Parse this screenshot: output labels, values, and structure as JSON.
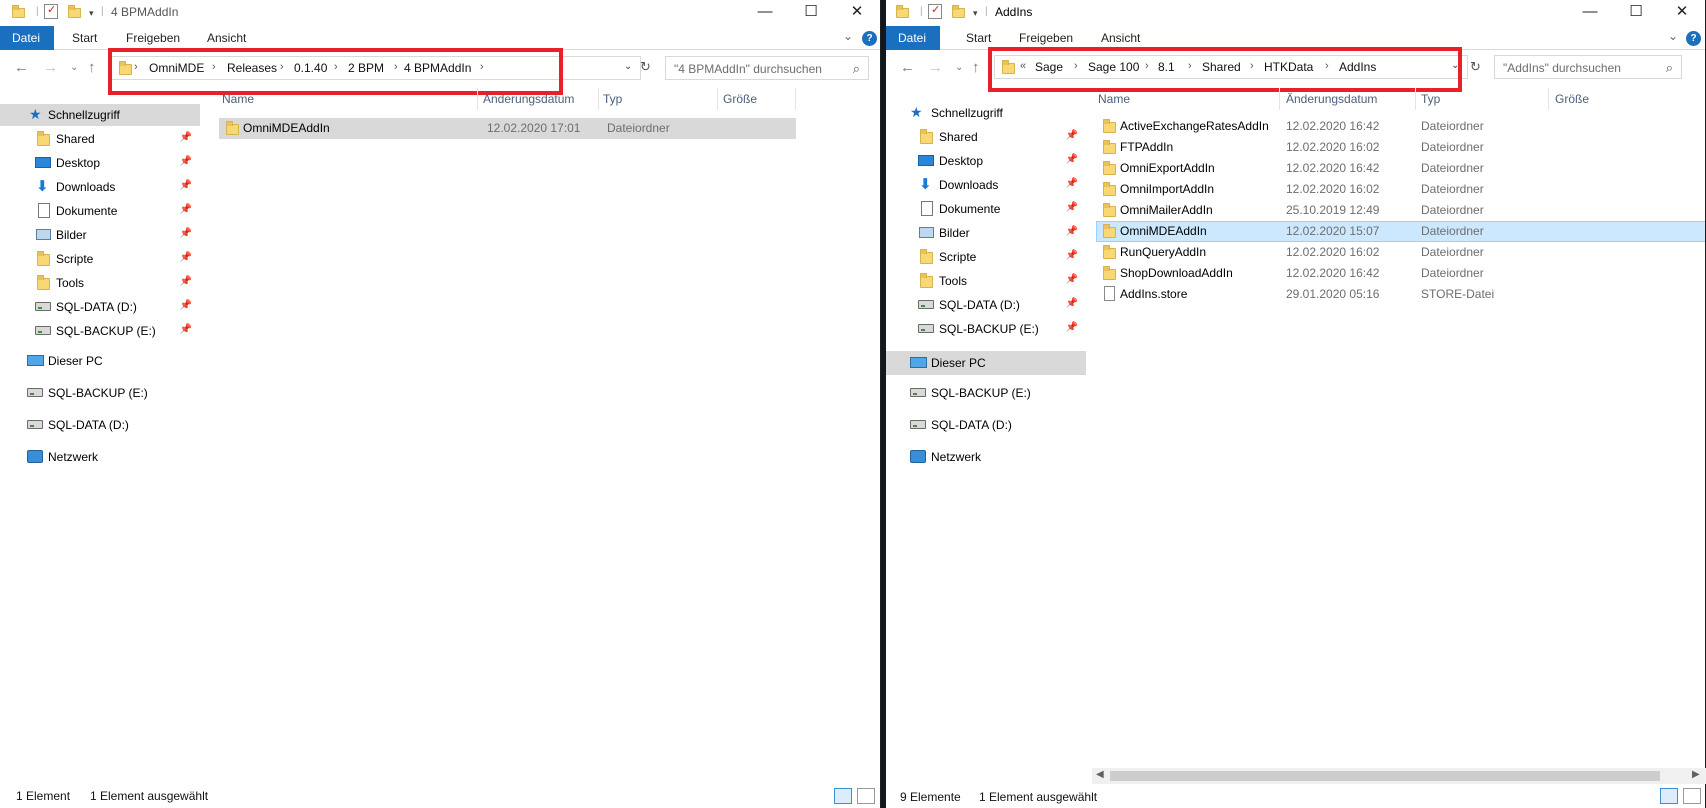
{
  "left": {
    "title": "4 BPMAddIn",
    "tabs": {
      "file": "Datei",
      "start": "Start",
      "share": "Freigeben",
      "view": "Ansicht"
    },
    "breadcrumb": [
      "OmniMDE",
      "Releases",
      "0.1.40",
      "2 BPM",
      "4 BPMAddIn"
    ],
    "search_placeholder": "\"4 BPMAddIn\" durchsuchen",
    "nav": {
      "quick_access": "Schnellzugriff",
      "pinned": [
        "Shared",
        "Desktop",
        "Downloads",
        "Dokumente",
        "Bilder",
        "Scripte",
        "Tools",
        "SQL-DATA (D:)",
        "SQL-BACKUP (E:)"
      ],
      "this_pc": "Dieser PC",
      "drives": [
        "SQL-BACKUP (E:)",
        "SQL-DATA (D:)"
      ],
      "network": "Netzwerk"
    },
    "columns": {
      "name": "Name",
      "date": "Änderungsdatum",
      "type": "Typ",
      "size": "Größe"
    },
    "files": [
      {
        "name": "OmniMDEAddIn",
        "date": "12.02.2020 17:01",
        "type": "Dateiordner"
      }
    ],
    "status": {
      "count": "1 Element",
      "selected": "1 Element ausgewählt"
    }
  },
  "right": {
    "title": "AddIns",
    "tabs": {
      "file": "Datei",
      "start": "Start",
      "share": "Freigeben",
      "view": "Ansicht"
    },
    "breadcrumb_prefix": "«",
    "breadcrumb": [
      "Sage",
      "Sage 100",
      "8.1",
      "Shared",
      "HTKData",
      "AddIns"
    ],
    "search_placeholder": "\"AddIns\" durchsuchen",
    "nav": {
      "quick_access": "Schnellzugriff",
      "pinned": [
        "Shared",
        "Desktop",
        "Downloads",
        "Dokumente",
        "Bilder",
        "Scripte",
        "Tools",
        "SQL-DATA (D:)",
        "SQL-BACKUP (E:)"
      ],
      "this_pc": "Dieser PC",
      "drives": [
        "SQL-BACKUP (E:)",
        "SQL-DATA (D:)"
      ],
      "network": "Netzwerk"
    },
    "columns": {
      "name": "Name",
      "date": "Änderungsdatum",
      "type": "Typ",
      "size": "Größe"
    },
    "files": [
      {
        "name": "ActiveExchangeRatesAddIn",
        "date": "12.02.2020 16:42",
        "type": "Dateiordner"
      },
      {
        "name": "FTPAddIn",
        "date": "12.02.2020 16:02",
        "type": "Dateiordner"
      },
      {
        "name": "OmniExportAddIn",
        "date": "12.02.2020 16:42",
        "type": "Dateiordner"
      },
      {
        "name": "OmniImportAddIn",
        "date": "12.02.2020 16:02",
        "type": "Dateiordner"
      },
      {
        "name": "OmniMailerAddIn",
        "date": "25.10.2019 12:49",
        "type": "Dateiordner"
      },
      {
        "name": "OmniMDEAddIn",
        "date": "12.02.2020 15:07",
        "type": "Dateiordner"
      },
      {
        "name": "RunQueryAddIn",
        "date": "12.02.2020 16:02",
        "type": "Dateiordner"
      },
      {
        "name": "ShopDownloadAddIn",
        "date": "12.02.2020 16:42",
        "type": "Dateiordner"
      },
      {
        "name": "AddIns.store",
        "date": "29.01.2020 05:16",
        "type": "STORE-Datei"
      }
    ],
    "status": {
      "count": "9 Elemente",
      "selected": "1 Element ausgewählt"
    }
  },
  "colors": {
    "accent": "#1a6fbf",
    "highlight_box": "#e8202a",
    "selection_blue": "#cce8ff",
    "selection_grey": "#d9d9d9",
    "folder": "#f8d775"
  }
}
